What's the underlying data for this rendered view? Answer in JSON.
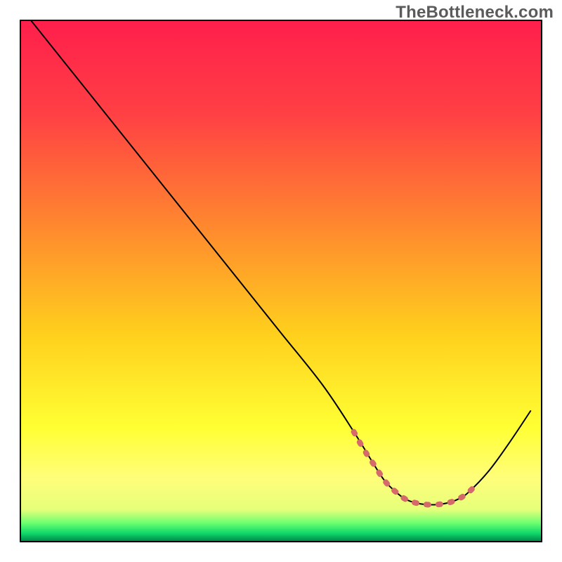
{
  "watermark": "TheBottleneck.com",
  "chart_data": {
    "type": "line",
    "title": "",
    "xlabel": "",
    "ylabel": "",
    "xlim": [
      0,
      100
    ],
    "ylim": [
      0,
      100
    ],
    "grid": false,
    "legend": false,
    "gradient": {
      "direction": "vertical",
      "stops": [
        {
          "offset": 0.0,
          "color": "#ff1f4c"
        },
        {
          "offset": 0.18,
          "color": "#ff4044"
        },
        {
          "offset": 0.4,
          "color": "#ff8a2e"
        },
        {
          "offset": 0.6,
          "color": "#ffcf1d"
        },
        {
          "offset": 0.78,
          "color": "#ffff33"
        },
        {
          "offset": 0.88,
          "color": "#fffe7a"
        },
        {
          "offset": 0.94,
          "color": "#e6ff7a"
        },
        {
          "offset": 0.965,
          "color": "#6fff70"
        },
        {
          "offset": 0.985,
          "color": "#10d96a"
        },
        {
          "offset": 1.0,
          "color": "#008c4a"
        }
      ]
    },
    "series": [
      {
        "name": "bottleneck-curve",
        "color": "#000000",
        "width": 2.0,
        "x": [
          2.0,
          10.0,
          18.0,
          26.0,
          34.0,
          42.0,
          50.0,
          58.0,
          64.0,
          68.0,
          70.0,
          72.0,
          74.0,
          76.0,
          78.0,
          80.0,
          82.0,
          84.0,
          86.0,
          90.0,
          94.0,
          98.0
        ],
        "y": [
          100.0,
          90.0,
          80.0,
          70.0,
          60.0,
          50.0,
          40.0,
          30.0,
          21.0,
          14.5,
          11.5,
          9.5,
          8.0,
          7.3,
          7.0,
          7.0,
          7.3,
          8.0,
          9.3,
          13.5,
          19.0,
          25.0
        ]
      },
      {
        "name": "optimal-zone-marker",
        "color": "#d46a6a",
        "width": 8.0,
        "dashed": true,
        "x": [
          64.0,
          66.0,
          68.0,
          70.0,
          72.0,
          74.0,
          76.0,
          78.0,
          80.0,
          82.0,
          84.0,
          86.0,
          88.0
        ],
        "y": [
          21.0,
          17.5,
          14.5,
          11.5,
          9.5,
          8.0,
          7.3,
          7.0,
          7.0,
          7.3,
          8.0,
          9.3,
          11.3
        ]
      }
    ],
    "annotations": []
  }
}
